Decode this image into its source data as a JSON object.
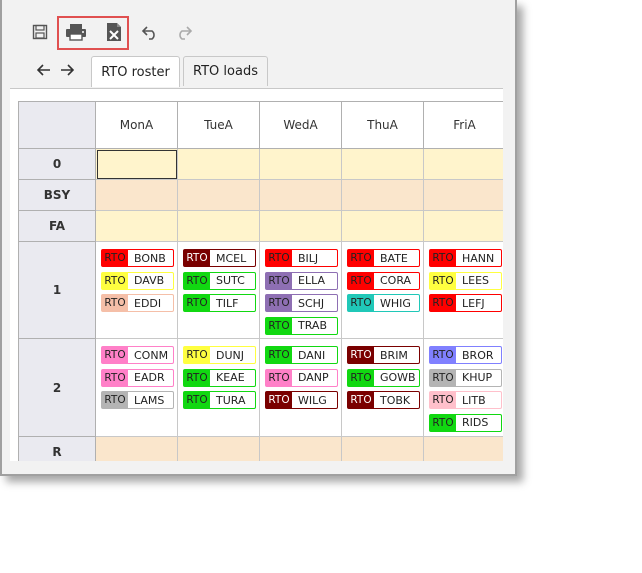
{
  "toolbar": {
    "save_icon": "save-icon",
    "print_icon": "printer-icon",
    "export_icon": "excel-export-icon",
    "undo_icon": "undo-icon",
    "redo_icon": "redo-icon",
    "back_icon": "arrow-left-icon",
    "forward_icon": "arrow-right-icon"
  },
  "tabs": [
    {
      "label": "RTO roster",
      "active": true
    },
    {
      "label": "RTO loads",
      "active": false
    }
  ],
  "columns": [
    "MonA",
    "TueA",
    "WedA",
    "ThuA",
    "FriA"
  ],
  "rows": [
    "0",
    "BSY",
    "FA",
    "1",
    "2",
    "R"
  ],
  "chip_prefix": "RTO",
  "colors": {
    "red": "#ff0000",
    "maroon": "#7a0000",
    "yellow": "#ffff40",
    "green": "#11d811",
    "purple": "#8e6fb3",
    "teal": "#20c8b8",
    "salmon": "#f5bfa8",
    "pink": "#ff80c8",
    "grey": "#b4b4b4",
    "lavender": "#8080ff",
    "lightpink": "#ffc0cb"
  },
  "row1": [
    [
      {
        "code": "BONB",
        "color": "red"
      },
      {
        "code": "DAVB",
        "color": "yellow"
      },
      {
        "code": "EDDI",
        "color": "salmon"
      }
    ],
    [
      {
        "code": "MCEL",
        "color": "maroon"
      },
      {
        "code": "SUTC",
        "color": "green"
      },
      {
        "code": "TILF",
        "color": "green"
      }
    ],
    [
      {
        "code": "BILJ",
        "color": "red"
      },
      {
        "code": "ELLA",
        "color": "purple"
      },
      {
        "code": "SCHJ",
        "color": "purple"
      },
      {
        "code": "TRAB",
        "color": "green"
      }
    ],
    [
      {
        "code": "BATE",
        "color": "red"
      },
      {
        "code": "CORA",
        "color": "red"
      },
      {
        "code": "WHIG",
        "color": "teal"
      }
    ],
    [
      {
        "code": "HANN",
        "color": "red"
      },
      {
        "code": "LEES",
        "color": "yellow"
      },
      {
        "code": "LEFJ",
        "color": "red"
      }
    ]
  ],
  "row2": [
    [
      {
        "code": "CONM",
        "color": "pink"
      },
      {
        "code": "EADR",
        "color": "pink"
      },
      {
        "code": "LAMS",
        "color": "grey"
      }
    ],
    [
      {
        "code": "DUNJ",
        "color": "yellow"
      },
      {
        "code": "KEAE",
        "color": "green"
      },
      {
        "code": "TURA",
        "color": "green"
      }
    ],
    [
      {
        "code": "DANI",
        "color": "green"
      },
      {
        "code": "DANP",
        "color": "pink"
      },
      {
        "code": "WILG",
        "color": "maroon"
      }
    ],
    [
      {
        "code": "BRIM",
        "color": "maroon"
      },
      {
        "code": "GOWB",
        "color": "green"
      },
      {
        "code": "TOBK",
        "color": "maroon"
      }
    ],
    [
      {
        "code": "BROR",
        "color": "lavender"
      },
      {
        "code": "KHUP",
        "color": "grey"
      },
      {
        "code": "LITB",
        "color": "lightpink"
      },
      {
        "code": "RIDS",
        "color": "green"
      }
    ]
  ]
}
